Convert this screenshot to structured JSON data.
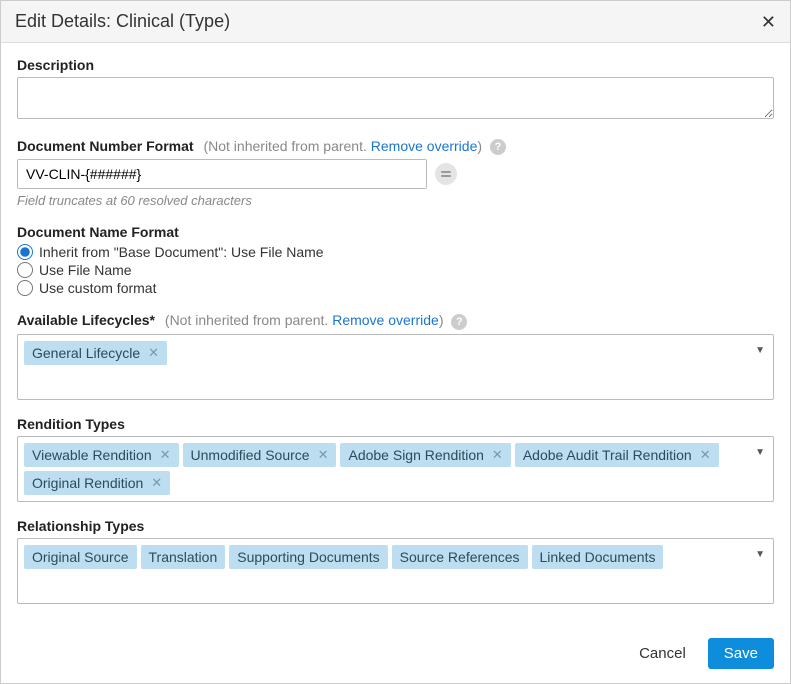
{
  "header": {
    "title": "Edit Details: Clinical (Type)"
  },
  "description": {
    "label": "Description",
    "value": ""
  },
  "doc_number": {
    "label": "Document Number Format",
    "hint_prefix": "(Not inherited from parent. ",
    "remove_link": "Remove override",
    "hint_suffix": ")",
    "value": "VV-CLIN-{######}",
    "helper": "Field truncates at 60 resolved characters"
  },
  "doc_name": {
    "label": "Document Name Format",
    "options": [
      "Inherit from \"Base Document\": Use File Name",
      "Use File Name",
      "Use custom format"
    ],
    "selected_index": 0
  },
  "lifecycles": {
    "label": "Available Lifecycles*",
    "hint_prefix": "(Not inherited from parent. ",
    "remove_link": "Remove override",
    "hint_suffix": ")",
    "tags": [
      {
        "label": "General Lifecycle",
        "removable": true
      }
    ]
  },
  "renditions": {
    "label": "Rendition Types",
    "tags": [
      {
        "label": "Viewable Rendition",
        "removable": true
      },
      {
        "label": "Unmodified Source",
        "removable": true
      },
      {
        "label": "Adobe Sign Rendition",
        "removable": true
      },
      {
        "label": "Adobe Audit Trail Rendition",
        "removable": true
      },
      {
        "label": "Original Rendition",
        "removable": true
      }
    ]
  },
  "relationships": {
    "label": "Relationship Types",
    "tags": [
      {
        "label": "Original Source",
        "removable": false
      },
      {
        "label": "Translation",
        "removable": false
      },
      {
        "label": "Supporting Documents",
        "removable": false
      },
      {
        "label": "Source References",
        "removable": false
      },
      {
        "label": "Linked Documents",
        "removable": false
      }
    ]
  },
  "footer": {
    "cancel": "Cancel",
    "save": "Save"
  }
}
